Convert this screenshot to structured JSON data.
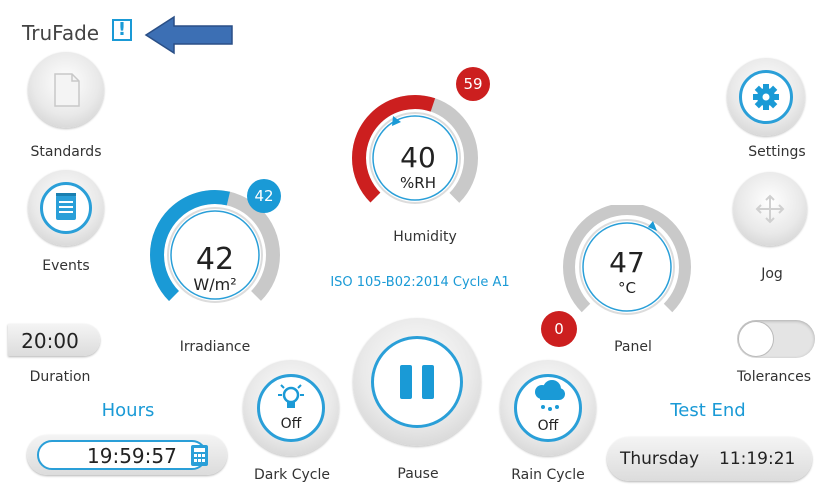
{
  "app": {
    "title": "TruFade",
    "alert_glyph": "!"
  },
  "nav": {
    "standards_label": "Standards",
    "events_label": "Events",
    "settings_label": "Settings",
    "jog_label": "Jog",
    "tolerances_label": "Tolerances"
  },
  "duration": {
    "value": "20:00",
    "label": "Duration"
  },
  "hours": {
    "label": "Hours",
    "value": "19:59:57"
  },
  "test_end": {
    "label": "Test End",
    "day": "Thursday",
    "time": "11:19:21"
  },
  "cycle_name": "ISO 105-B02:2014 Cycle A1",
  "gauges": {
    "humidity": {
      "value": "40",
      "unit": "%RH",
      "setpoint": "59",
      "label": "Humidity"
    },
    "irradiance": {
      "value": "42",
      "unit": "W/m²",
      "setpoint": "42",
      "label": "Irradiance"
    },
    "panel": {
      "value": "47",
      "unit": "°C",
      "setpoint": "0",
      "label": "Panel"
    }
  },
  "controls": {
    "dark_cycle": {
      "state": "Off",
      "label": "Dark Cycle"
    },
    "pause": {
      "label": "Pause"
    },
    "rain_cycle": {
      "state": "Off",
      "label": "Rain Cycle"
    }
  },
  "toggles": {
    "tolerances_on": false
  },
  "colors": {
    "accent": "#1a9ad6",
    "alarm": "#cc1f1f",
    "arrow": "#3c6fb4"
  },
  "icons": [
    "document-icon",
    "notebook-icon",
    "gear-icon",
    "move-arrows-icon",
    "lightbulb-icon",
    "pause-icon",
    "rain-cloud-icon",
    "calculator-icon"
  ]
}
